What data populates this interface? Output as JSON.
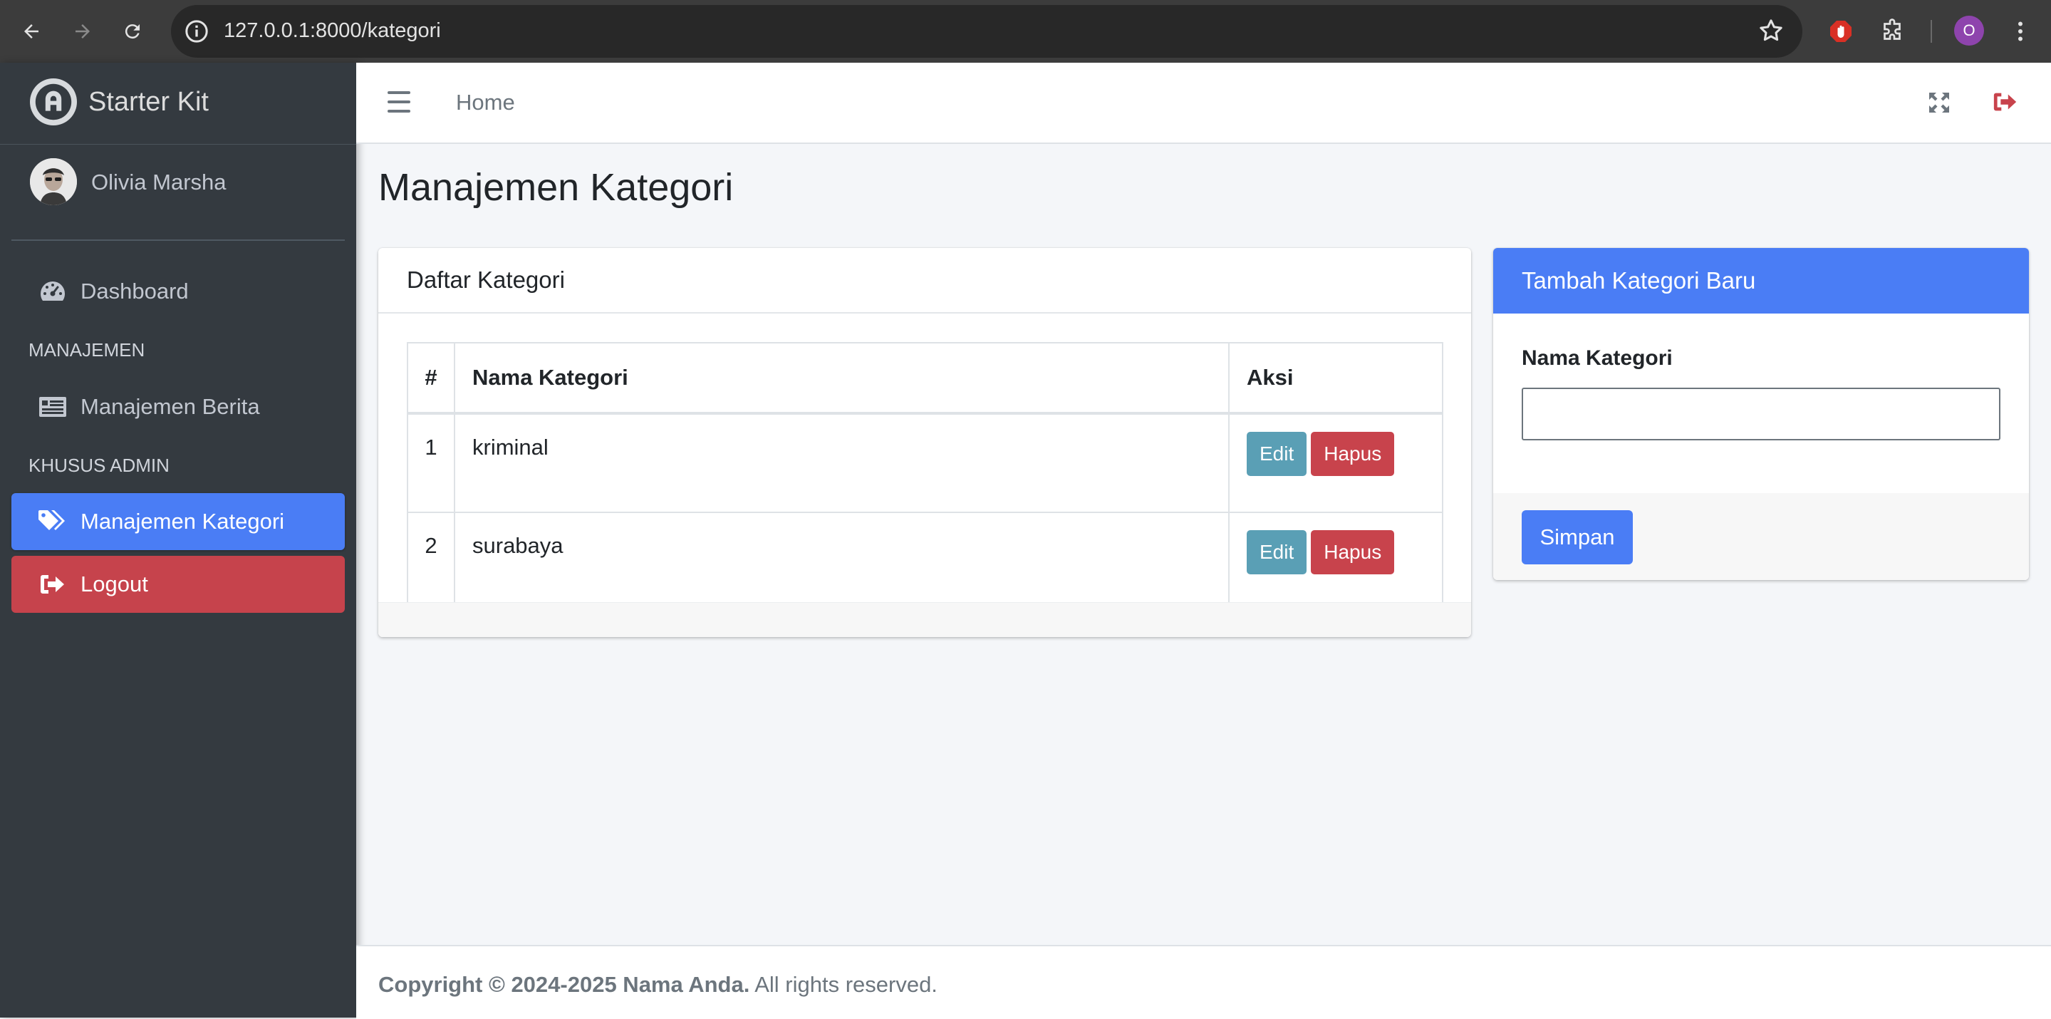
{
  "browser": {
    "url": "127.0.0.1:8000/kategori",
    "profile_initial": "O"
  },
  "sidebar": {
    "brand": "Starter Kit",
    "user_name": "Olivia Marsha",
    "items": [
      {
        "label": "Dashboard",
        "icon": "tachometer-icon"
      },
      {
        "header": "MANAJEMEN"
      },
      {
        "label": "Manajemen Berita",
        "icon": "newspaper-icon"
      },
      {
        "header": "KHUSUS ADMIN"
      },
      {
        "label": "Manajemen Kategori",
        "icon": "tags-icon",
        "active": true
      },
      {
        "label": "Logout",
        "icon": "sign-out-icon"
      }
    ]
  },
  "header": {
    "home_label": "Home"
  },
  "page": {
    "title": "Manajemen Kategori"
  },
  "list_card": {
    "title": "Daftar Kategori",
    "columns": [
      "#",
      "Nama Kategori",
      "Aksi"
    ],
    "rows": [
      {
        "num": "1",
        "name": "kriminal"
      },
      {
        "num": "2",
        "name": "surabaya"
      }
    ],
    "edit_label": "Edit",
    "delete_label": "Hapus"
  },
  "form_card": {
    "title": "Tambah Kategori Baru",
    "field_label": "Nama Kategori",
    "field_value": "",
    "submit_label": "Simpan"
  },
  "footer": {
    "copyright_bold": "Copyright © 2024-2025 Nama Anda.",
    "copyright_rest": "All rights reserved."
  },
  "colors": {
    "primary": "#4a7df5",
    "danger": "#c8434c",
    "info": "#5a9fb5",
    "sidebar_bg": "#343a40"
  }
}
